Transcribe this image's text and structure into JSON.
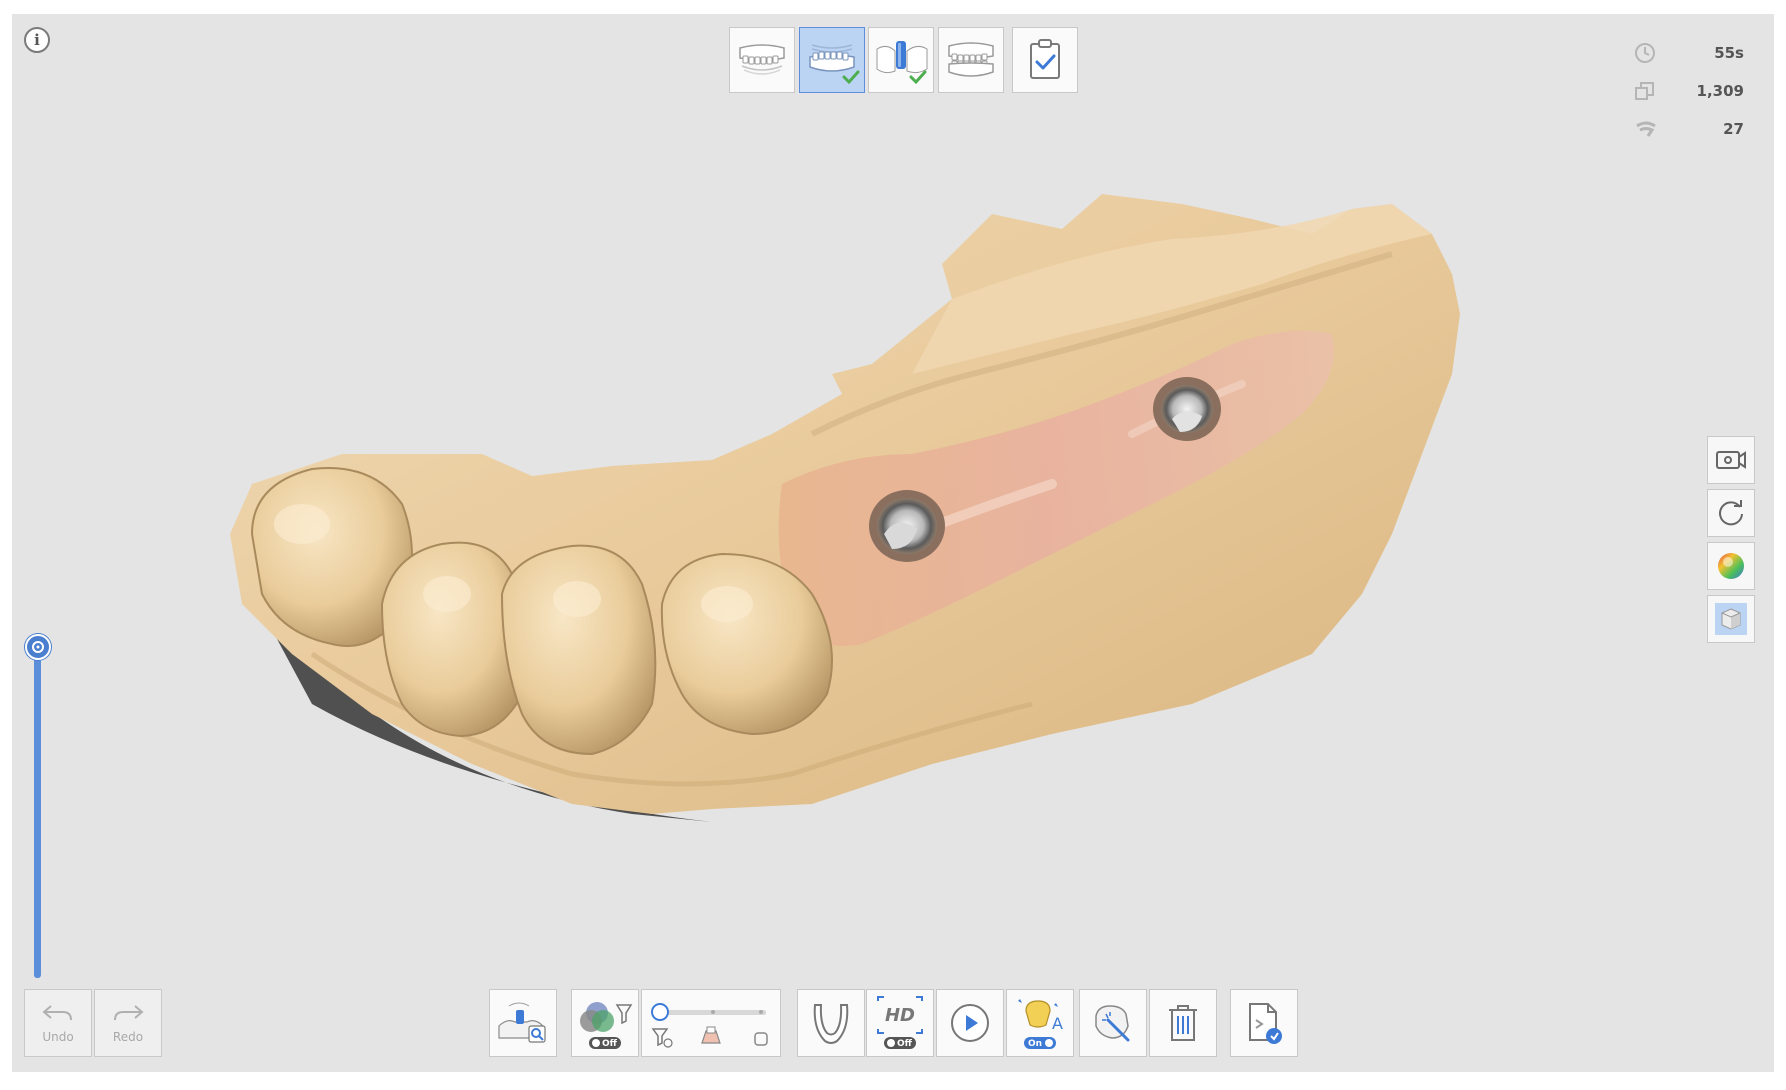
{
  "app": {
    "info_label": "i"
  },
  "stages": [
    {
      "name": "upper-jaw",
      "checked": false,
      "active": false
    },
    {
      "name": "lower-jaw",
      "checked": true,
      "active": true
    },
    {
      "name": "scan-body",
      "checked": true,
      "active": false
    },
    {
      "name": "occlusion",
      "checked": false,
      "active": false
    }
  ],
  "stats": {
    "time": "55s",
    "frames": "1,309",
    "count": "27"
  },
  "history": {
    "undo_label": "Undo",
    "redo_label": "Redo"
  },
  "toolbar": {
    "filter_toggle": "Off",
    "hd_label": "HD",
    "hd_toggle": "Off",
    "ai_toggle": "On"
  },
  "slider": {
    "level": 0.0
  },
  "colors": {
    "accent": "#5b8fd9",
    "viewport_bg": "#e4e4e4",
    "check": "#4cae4f"
  }
}
